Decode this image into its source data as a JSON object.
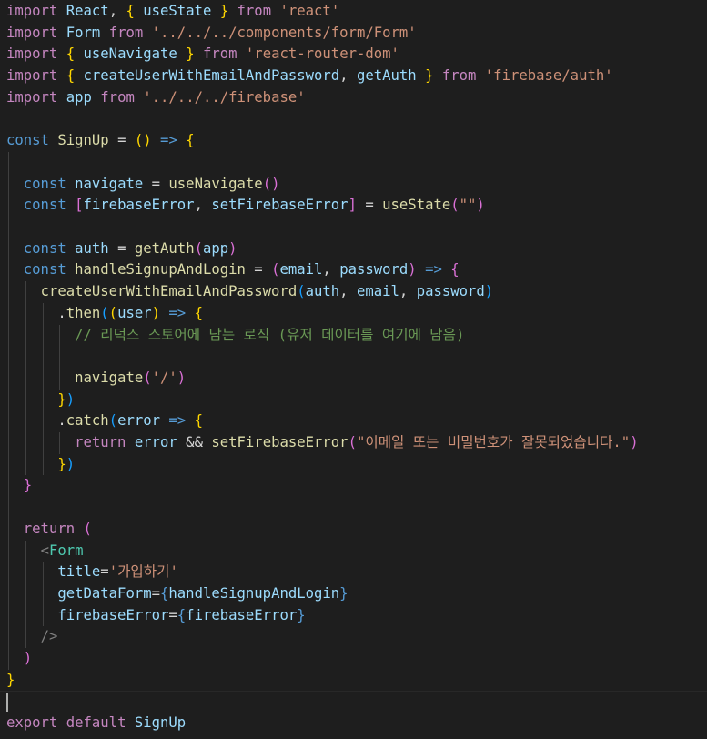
{
  "editor": {
    "theme_colors": {
      "background": "#1e1e1e",
      "keyword_control": "#c586c0",
      "keyword_storage": "#569cd6",
      "variable": "#9cdcfe",
      "function": "#dcdcaa",
      "string": "#ce9178",
      "comment": "#6a9955",
      "component": "#4ec9b0",
      "bracket_1": "#ffd700",
      "bracket_2": "#da70d6",
      "bracket_3": "#179fff"
    },
    "lines": [
      [
        [
          "k",
          "import"
        ],
        [
          "p",
          " "
        ],
        [
          "v",
          "React"
        ],
        [
          "p",
          ", "
        ],
        [
          "b1",
          "{"
        ],
        [
          "p",
          " "
        ],
        [
          "v",
          "useState"
        ],
        [
          "p",
          " "
        ],
        [
          "b1",
          "}"
        ],
        [
          "p",
          " "
        ],
        [
          "k",
          "from"
        ],
        [
          "p",
          " "
        ],
        [
          "s",
          "'react'"
        ]
      ],
      [
        [
          "k",
          "import"
        ],
        [
          "p",
          " "
        ],
        [
          "v",
          "Form"
        ],
        [
          "p",
          " "
        ],
        [
          "k",
          "from"
        ],
        [
          "p",
          " "
        ],
        [
          "s",
          "'../../../components/form/Form'"
        ]
      ],
      [
        [
          "k",
          "import"
        ],
        [
          "p",
          " "
        ],
        [
          "b1",
          "{"
        ],
        [
          "p",
          " "
        ],
        [
          "v",
          "useNavigate"
        ],
        [
          "p",
          " "
        ],
        [
          "b1",
          "}"
        ],
        [
          "p",
          " "
        ],
        [
          "k",
          "from"
        ],
        [
          "p",
          " "
        ],
        [
          "s",
          "'react-router-dom'"
        ]
      ],
      [
        [
          "k",
          "import"
        ],
        [
          "p",
          " "
        ],
        [
          "b1",
          "{"
        ],
        [
          "p",
          " "
        ],
        [
          "v",
          "createUserWithEmailAndPassword"
        ],
        [
          "p",
          ", "
        ],
        [
          "v",
          "getAuth"
        ],
        [
          "p",
          " "
        ],
        [
          "b1",
          "}"
        ],
        [
          "p",
          " "
        ],
        [
          "k",
          "from"
        ],
        [
          "p",
          " "
        ],
        [
          "s",
          "'firebase/auth'"
        ]
      ],
      [
        [
          "k",
          "import"
        ],
        [
          "p",
          " "
        ],
        [
          "v",
          "app"
        ],
        [
          "p",
          " "
        ],
        [
          "k",
          "from"
        ],
        [
          "p",
          " "
        ],
        [
          "s",
          "'../../../firebase'"
        ]
      ],
      [],
      [
        [
          "kb",
          "const"
        ],
        [
          "p",
          " "
        ],
        [
          "f",
          "SignUp"
        ],
        [
          "p",
          " = "
        ],
        [
          "b1",
          "()"
        ],
        [
          "p",
          " "
        ],
        [
          "kb",
          "=>"
        ],
        [
          "p",
          " "
        ],
        [
          "b1",
          "{"
        ]
      ],
      [],
      [
        [
          "p",
          "  "
        ],
        [
          "kb",
          "const"
        ],
        [
          "p",
          " "
        ],
        [
          "v",
          "navigate"
        ],
        [
          "p",
          " = "
        ],
        [
          "f",
          "useNavigate"
        ],
        [
          "b2",
          "()"
        ]
      ],
      [
        [
          "p",
          "  "
        ],
        [
          "kb",
          "const"
        ],
        [
          "p",
          " "
        ],
        [
          "b2",
          "["
        ],
        [
          "v",
          "firebaseError"
        ],
        [
          "p",
          ", "
        ],
        [
          "v",
          "setFirebaseError"
        ],
        [
          "b2",
          "]"
        ],
        [
          "p",
          " = "
        ],
        [
          "f",
          "useState"
        ],
        [
          "b2",
          "("
        ],
        [
          "s",
          "\"\""
        ],
        [
          "b2",
          ")"
        ]
      ],
      [],
      [
        [
          "p",
          "  "
        ],
        [
          "kb",
          "const"
        ],
        [
          "p",
          " "
        ],
        [
          "v",
          "auth"
        ],
        [
          "p",
          " = "
        ],
        [
          "f",
          "getAuth"
        ],
        [
          "b2",
          "("
        ],
        [
          "v",
          "app"
        ],
        [
          "b2",
          ")"
        ]
      ],
      [
        [
          "p",
          "  "
        ],
        [
          "kb",
          "const"
        ],
        [
          "p",
          " "
        ],
        [
          "f",
          "handleSignupAndLogin"
        ],
        [
          "p",
          " = "
        ],
        [
          "b2",
          "("
        ],
        [
          "v",
          "email"
        ],
        [
          "p",
          ", "
        ],
        [
          "v",
          "password"
        ],
        [
          "b2",
          ")"
        ],
        [
          "p",
          " "
        ],
        [
          "kb",
          "=>"
        ],
        [
          "p",
          " "
        ],
        [
          "b2",
          "{"
        ]
      ],
      [
        [
          "p",
          "    "
        ],
        [
          "f",
          "createUserWithEmailAndPassword"
        ],
        [
          "b3",
          "("
        ],
        [
          "v",
          "auth"
        ],
        [
          "p",
          ", "
        ],
        [
          "v",
          "email"
        ],
        [
          "p",
          ", "
        ],
        [
          "v",
          "password"
        ],
        [
          "b3",
          ")"
        ]
      ],
      [
        [
          "p",
          "      ."
        ],
        [
          "f",
          "then"
        ],
        [
          "b3",
          "("
        ],
        [
          "b1",
          "("
        ],
        [
          "v",
          "user"
        ],
        [
          "b1",
          ")"
        ],
        [
          "p",
          " "
        ],
        [
          "kb",
          "=>"
        ],
        [
          "p",
          " "
        ],
        [
          "b1",
          "{"
        ]
      ],
      [
        [
          "p",
          "        "
        ],
        [
          "c",
          "// 리덕스 스토어에 담는 로직 (유저 데이터를 여기에 담음)"
        ]
      ],
      [],
      [
        [
          "p",
          "        "
        ],
        [
          "f",
          "navigate"
        ],
        [
          "b2",
          "("
        ],
        [
          "s",
          "'/'"
        ],
        [
          "b2",
          ")"
        ]
      ],
      [
        [
          "p",
          "      "
        ],
        [
          "b1",
          "}"
        ],
        [
          "b3",
          ")"
        ]
      ],
      [
        [
          "p",
          "      ."
        ],
        [
          "f",
          "catch"
        ],
        [
          "b3",
          "("
        ],
        [
          "v",
          "error"
        ],
        [
          "p",
          " "
        ],
        [
          "kb",
          "=>"
        ],
        [
          "p",
          " "
        ],
        [
          "b1",
          "{"
        ]
      ],
      [
        [
          "p",
          "        "
        ],
        [
          "k",
          "return"
        ],
        [
          "p",
          " "
        ],
        [
          "v",
          "error"
        ],
        [
          "p",
          " && "
        ],
        [
          "f",
          "setFirebaseError"
        ],
        [
          "b2",
          "("
        ],
        [
          "s",
          "\"이메일 또는 비밀번호가 잘못되었습니다.\""
        ],
        [
          "b2",
          ")"
        ]
      ],
      [
        [
          "p",
          "      "
        ],
        [
          "b1",
          "}"
        ],
        [
          "b3",
          ")"
        ]
      ],
      [
        [
          "p",
          "  "
        ],
        [
          "b2",
          "}"
        ]
      ],
      [],
      [
        [
          "p",
          "  "
        ],
        [
          "k",
          "return"
        ],
        [
          "p",
          " "
        ],
        [
          "b2",
          "("
        ]
      ],
      [
        [
          "p",
          "    "
        ],
        [
          "tag",
          "<"
        ],
        [
          "t",
          "Form"
        ]
      ],
      [
        [
          "p",
          "      "
        ],
        [
          "v",
          "title"
        ],
        [
          "p",
          "="
        ],
        [
          "s",
          "'가입하기'"
        ]
      ],
      [
        [
          "p",
          "      "
        ],
        [
          "v",
          "getDataForm"
        ],
        [
          "p",
          "="
        ],
        [
          "kb",
          "{"
        ],
        [
          "v",
          "handleSignupAndLogin"
        ],
        [
          "kb",
          "}"
        ]
      ],
      [
        [
          "p",
          "      "
        ],
        [
          "v",
          "firebaseError"
        ],
        [
          "p",
          "="
        ],
        [
          "kb",
          "{"
        ],
        [
          "v",
          "firebaseError"
        ],
        [
          "kb",
          "}"
        ]
      ],
      [
        [
          "p",
          "    "
        ],
        [
          "tag",
          "/>"
        ]
      ],
      [
        [
          "p",
          "  "
        ],
        [
          "b2",
          ")"
        ]
      ],
      [
        [
          "b1",
          "}"
        ]
      ],
      [],
      [
        [
          "k",
          "export"
        ],
        [
          "p",
          " "
        ],
        [
          "k",
          "default"
        ],
        [
          "p",
          " "
        ],
        [
          "v",
          "SignUp"
        ]
      ]
    ]
  }
}
